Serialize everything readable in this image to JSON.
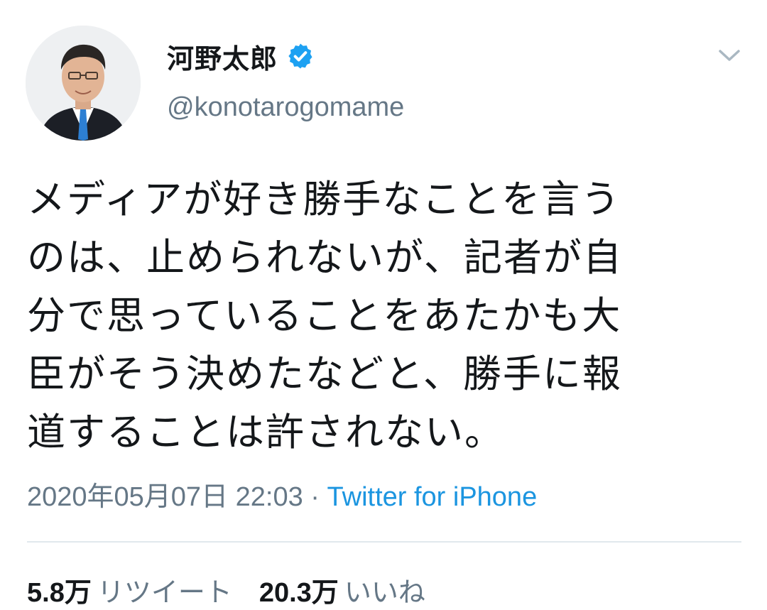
{
  "author": {
    "display_name": "河野太郎",
    "handle": "@konotarogomame",
    "verified": true
  },
  "tweet": {
    "text": "メディアが好き勝手なことを言う\nのは、止められないが、記者が自\n分で思っていることをあたかも大\n臣がそう決めたなどと、勝手に報\n道することは許されない。",
    "timestamp": "2020年05月07日 22:03",
    "separator": " · ",
    "source": "Twitter for iPhone"
  },
  "stats": {
    "retweets_count": "5.8万",
    "retweets_label": "リツイート",
    "likes_count": "20.3万",
    "likes_label": "いいね"
  },
  "icons": {
    "verified": "verified-badge-icon",
    "menu": "chevron-down-icon"
  },
  "colors": {
    "verified": "#1da1f2",
    "link": "#1b95e0",
    "secondary_text": "#657786",
    "primary_text": "#14171a",
    "divider": "#e1e8ed"
  }
}
